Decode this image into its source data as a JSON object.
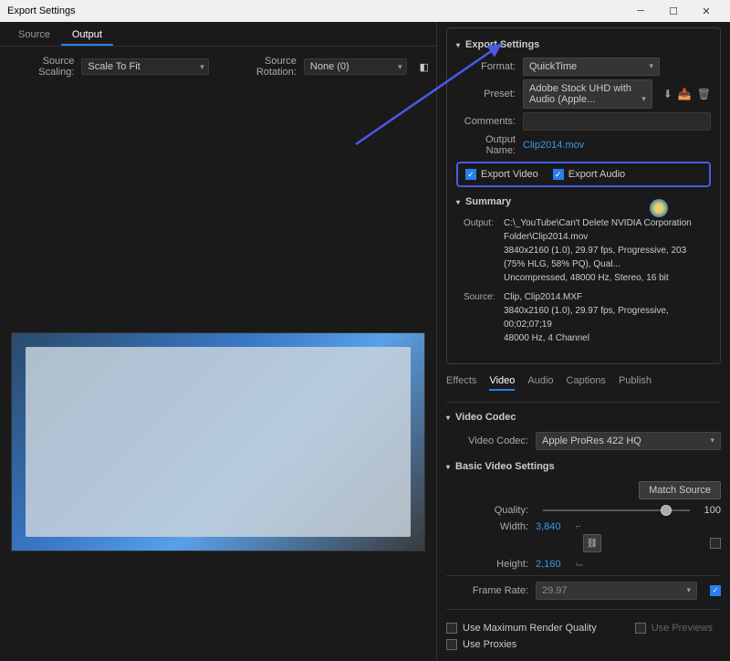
{
  "window": {
    "title": "Export Settings"
  },
  "left": {
    "tabs": {
      "source": "Source",
      "output": "Output"
    },
    "scaling_label": "Source Scaling:",
    "scaling_value": "Scale To Fit",
    "rotation_label": "Source Rotation:",
    "rotation_value": "None (0)"
  },
  "export": {
    "header": "Export Settings",
    "format_label": "Format:",
    "format_value": "QuickTime",
    "preset_label": "Preset:",
    "preset_value": "Adobe Stock UHD with Audio (Apple...",
    "comments_label": "Comments:",
    "comments_value": "",
    "outputname_label": "Output Name:",
    "outputname_value": "Clip2014.mov",
    "export_video": "Export Video",
    "export_audio": "Export Audio"
  },
  "summary": {
    "header": "Summary",
    "output_label": "Output:",
    "output_text": "C:\\_YouTube\\Can't Delete NVIDIA Corporation Folder\\Clip2014.mov\n3840x2160 (1.0), 29.97 fps, Progressive, 203 (75% HLG, 58% PQ), Qual...\nUncompressed, 48000 Hz, Stereo, 16 bit",
    "source_label": "Source:",
    "source_text": "Clip, Clip2014.MXF\n3840x2160 (1.0), 29.97 fps, Progressive, 00;02;07;19\n48000 Hz, 4 Channel"
  },
  "tabs": {
    "effects": "Effects",
    "video": "Video",
    "audio": "Audio",
    "captions": "Captions",
    "publish": "Publish"
  },
  "codec": {
    "header": "Video Codec",
    "label": "Video Codec:",
    "value": "Apple ProRes 422 HQ"
  },
  "basic": {
    "header": "Basic Video Settings",
    "match": "Match Source",
    "quality_label": "Quality:",
    "quality_value": "100",
    "width_label": "Width:",
    "width_value": "3,840",
    "height_label": "Height:",
    "height_value": "2,160",
    "framerate_label": "Frame Rate:",
    "framerate_value": "29.97"
  },
  "bottom": {
    "max_quality": "Use Maximum Render Quality",
    "previews": "Use Previews",
    "proxies": "Use Proxies"
  }
}
